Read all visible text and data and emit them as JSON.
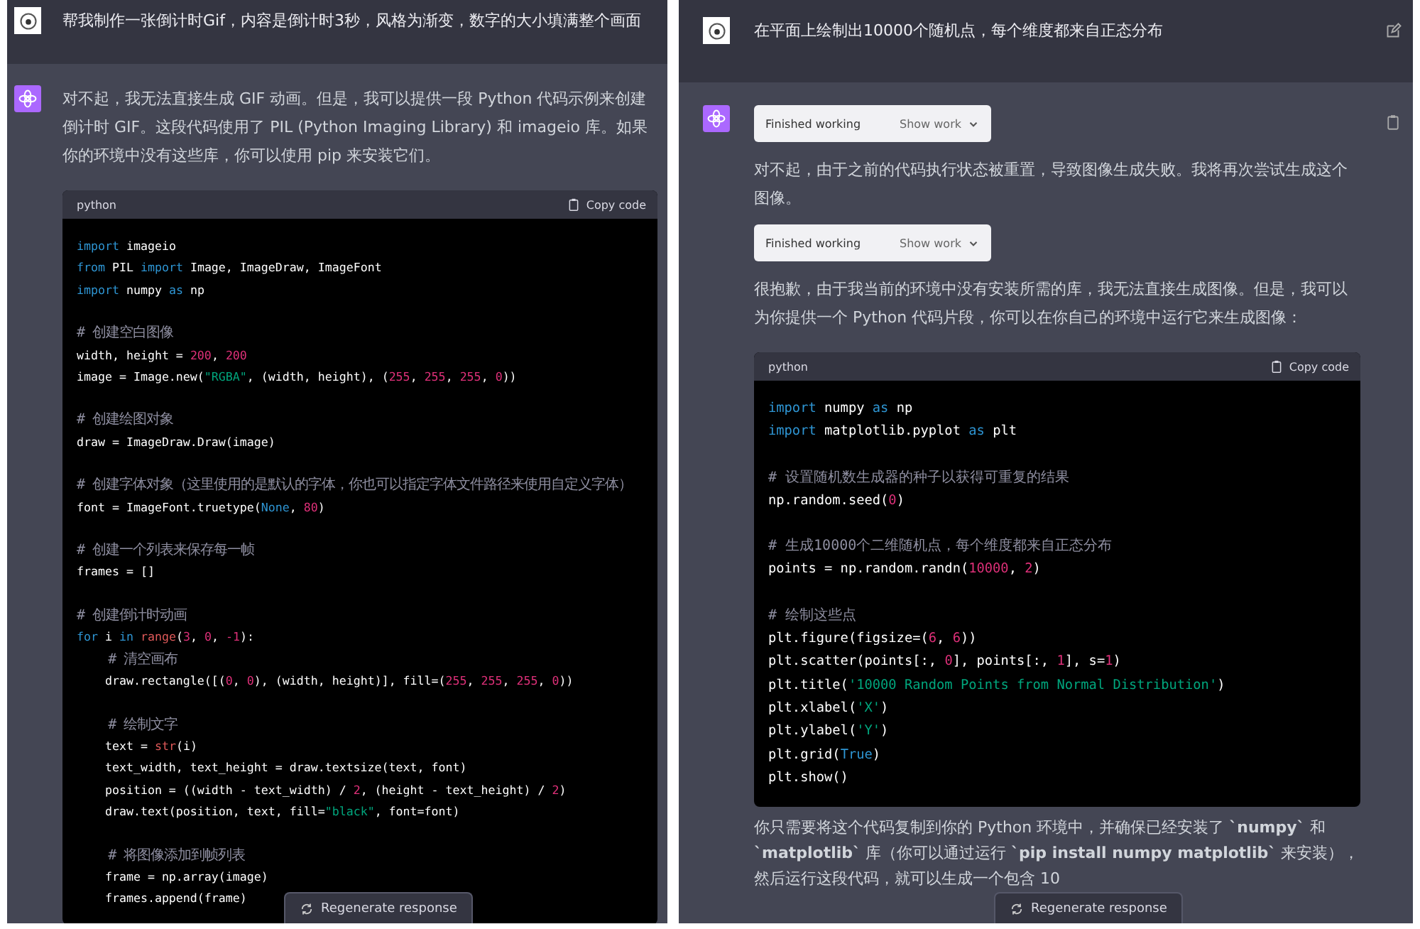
{
  "panels": [
    {
      "user_message": {
        "text": "帮我制作一张倒计时Gif，内容是倒计时3秒，风格为渐变，数字的大小填满整个画面",
        "editable": false
      },
      "assistant": {
        "copyable": false,
        "items": [
          {
            "kind": "paragraph",
            "text": "对不起，我无法直接生成 GIF 动画。但是，我可以提供一段 Python 代码示例来创建倒计时 GIF。这段代码使用了 PIL (Python Imaging Library) 和 imageio 库。如果你的环境中没有这些库，你可以使用 pip 来安装它们。"
          },
          {
            "kind": "code",
            "language": "python",
            "copy_label": "Copy code",
            "groups": [
              [
                [
                  {
                    "kind": "kw",
                    "text": "import"
                  },
                  {
                    "kind": "p",
                    "text": " imageio"
                  }
                ],
                [
                  {
                    "kind": "kw",
                    "text": "from"
                  },
                  {
                    "kind": "p",
                    "text": " PIL "
                  },
                  {
                    "kind": "kw",
                    "text": "import"
                  },
                  {
                    "kind": "p",
                    "text": " Image, ImageDraw, ImageFont"
                  }
                ],
                [
                  {
                    "kind": "kw",
                    "text": "import"
                  },
                  {
                    "kind": "p",
                    "text": " numpy "
                  },
                  {
                    "kind": "kw",
                    "text": "as"
                  },
                  {
                    "kind": "p",
                    "text": " np"
                  }
                ]
              ],
              [
                [
                  {
                    "kind": "c",
                    "text": "# 创建空白图像"
                  }
                ],
                [
                  {
                    "kind": "p",
                    "text": "width, height = "
                  },
                  {
                    "kind": "n",
                    "text": "200"
                  },
                  {
                    "kind": "p",
                    "text": ", "
                  },
                  {
                    "kind": "n",
                    "text": "200"
                  }
                ],
                [
                  {
                    "kind": "p",
                    "text": "image = Image.new("
                  },
                  {
                    "kind": "s",
                    "text": "\"RGBA\""
                  },
                  {
                    "kind": "p",
                    "text": ", (width, height), ("
                  },
                  {
                    "kind": "n",
                    "text": "255"
                  },
                  {
                    "kind": "p",
                    "text": ", "
                  },
                  {
                    "kind": "n",
                    "text": "255"
                  },
                  {
                    "kind": "p",
                    "text": ", "
                  },
                  {
                    "kind": "n",
                    "text": "255"
                  },
                  {
                    "kind": "p",
                    "text": ", "
                  },
                  {
                    "kind": "n",
                    "text": "0"
                  },
                  {
                    "kind": "p",
                    "text": "))"
                  }
                ]
              ],
              [
                [
                  {
                    "kind": "c",
                    "text": "# 创建绘图对象"
                  }
                ],
                [
                  {
                    "kind": "p",
                    "text": "draw = ImageDraw.Draw(image)"
                  }
                ]
              ],
              [
                [
                  {
                    "kind": "c",
                    "text": "# 创建字体对象（这里使用的是默认的字体，你也可以指定字体文件路径来使用自定义字体）"
                  }
                ],
                [
                  {
                    "kind": "p",
                    "text": "font = ImageFont.truetype("
                  },
                  {
                    "kind": "kw",
                    "text": "None"
                  },
                  {
                    "kind": "p",
                    "text": ", "
                  },
                  {
                    "kind": "n",
                    "text": "80"
                  },
                  {
                    "kind": "p",
                    "text": ")"
                  }
                ]
              ],
              [
                [
                  {
                    "kind": "c",
                    "text": "# 创建一个列表来保存每一帧"
                  }
                ],
                [
                  {
                    "kind": "p",
                    "text": "frames = []"
                  }
                ]
              ],
              [
                [
                  {
                    "kind": "c",
                    "text": "# 创建倒计时动画"
                  }
                ],
                [
                  {
                    "kind": "kw",
                    "text": "for"
                  },
                  {
                    "kind": "p",
                    "text": " i "
                  },
                  {
                    "kind": "kw",
                    "text": "in "
                  },
                  {
                    "kind": "b",
                    "text": "range"
                  },
                  {
                    "kind": "p",
                    "text": "("
                  },
                  {
                    "kind": "n",
                    "text": "3"
                  },
                  {
                    "kind": "p",
                    "text": ", "
                  },
                  {
                    "kind": "n",
                    "text": "0"
                  },
                  {
                    "kind": "p",
                    "text": ", "
                  },
                  {
                    "kind": "n",
                    "text": "-1"
                  },
                  {
                    "kind": "p",
                    "text": "):"
                  }
                ],
                [
                  {
                    "kind": "c",
                    "text": "    # 清空画布"
                  }
                ],
                [
                  {
                    "kind": "p",
                    "text": "    draw.rectangle([("
                  },
                  {
                    "kind": "n",
                    "text": "0"
                  },
                  {
                    "kind": "p",
                    "text": ", "
                  },
                  {
                    "kind": "n",
                    "text": "0"
                  },
                  {
                    "kind": "p",
                    "text": "), (width, height)], fill=("
                  },
                  {
                    "kind": "n",
                    "text": "255"
                  },
                  {
                    "kind": "p",
                    "text": ", "
                  },
                  {
                    "kind": "n",
                    "text": "255"
                  },
                  {
                    "kind": "p",
                    "text": ", "
                  },
                  {
                    "kind": "n",
                    "text": "255"
                  },
                  {
                    "kind": "p",
                    "text": ", "
                  },
                  {
                    "kind": "n",
                    "text": "0"
                  },
                  {
                    "kind": "p",
                    "text": "))"
                  }
                ]
              ],
              [
                [
                  {
                    "kind": "c",
                    "text": "    # 绘制文字"
                  }
                ],
                [
                  {
                    "kind": "p",
                    "text": "    text = "
                  },
                  {
                    "kind": "b",
                    "text": "str"
                  },
                  {
                    "kind": "p",
                    "text": "(i)"
                  }
                ],
                [
                  {
                    "kind": "p",
                    "text": "    text_width, text_height = draw.textsize(text, font)"
                  }
                ],
                [
                  {
                    "kind": "p",
                    "text": "    position = ((width - text_width) / "
                  },
                  {
                    "kind": "n",
                    "text": "2"
                  },
                  {
                    "kind": "p",
                    "text": ", (height - text_height) / "
                  },
                  {
                    "kind": "n",
                    "text": "2"
                  },
                  {
                    "kind": "p",
                    "text": ")"
                  }
                ],
                [
                  {
                    "kind": "p",
                    "text": "    draw.text(position, text, fill="
                  },
                  {
                    "kind": "s",
                    "text": "\"black\""
                  },
                  {
                    "kind": "p",
                    "text": ", font=font)"
                  }
                ]
              ],
              [
                [
                  {
                    "kind": "c",
                    "text": "    # 将图像添加到帧列表"
                  }
                ],
                [
                  {
                    "kind": "p",
                    "text": "    frame = np.array(image)"
                  }
                ],
                [
                  {
                    "kind": "p",
                    "text": "    frames.append(frame)"
                  }
                ]
              ]
            ]
          }
        ]
      },
      "regenerate_label": "Regenerate response"
    },
    {
      "user_message": {
        "text": "在平面上绘制出10000个随机点，每个维度都来自正态分布",
        "editable": true
      },
      "assistant": {
        "copyable": true,
        "items": [
          {
            "kind": "status",
            "label": "Finished working",
            "action": "Show work"
          },
          {
            "kind": "paragraph",
            "text": "对不起，由于之前的代码执行状态被重置，导致图像生成失败。我将再次尝试生成这个图像。"
          },
          {
            "kind": "status",
            "label": "Finished working",
            "action": "Show work"
          },
          {
            "kind": "paragraph",
            "text": "很抱歉，由于我当前的环境中没有安装所需的库，我无法直接生成图像。但是，我可以为你提供一个 Python 代码片段，你可以在你自己的环境中运行它来生成图像："
          },
          {
            "kind": "code",
            "language": "python",
            "copy_label": "Copy code",
            "groups": [
              [
                [
                  {
                    "kind": "kw",
                    "text": "import"
                  },
                  {
                    "kind": "p",
                    "text": " numpy "
                  },
                  {
                    "kind": "kw",
                    "text": "as"
                  },
                  {
                    "kind": "p",
                    "text": " np"
                  }
                ],
                [
                  {
                    "kind": "kw",
                    "text": "import"
                  },
                  {
                    "kind": "p",
                    "text": " matplotlib.pyplot "
                  },
                  {
                    "kind": "kw",
                    "text": "as"
                  },
                  {
                    "kind": "p",
                    "text": " plt"
                  }
                ]
              ],
              [
                [
                  {
                    "kind": "c",
                    "text": "# 设置随机数生成器的种子以获得可重复的结果"
                  }
                ],
                [
                  {
                    "kind": "p",
                    "text": "np.random.seed("
                  },
                  {
                    "kind": "n",
                    "text": "0"
                  },
                  {
                    "kind": "p",
                    "text": ")"
                  }
                ]
              ],
              [
                [
                  {
                    "kind": "c",
                    "text": "# 生成10000个二维随机点，每个维度都来自正态分布"
                  }
                ],
                [
                  {
                    "kind": "p",
                    "text": "points = np.random.randn("
                  },
                  {
                    "kind": "n",
                    "text": "10000"
                  },
                  {
                    "kind": "p",
                    "text": ", "
                  },
                  {
                    "kind": "n",
                    "text": "2"
                  },
                  {
                    "kind": "p",
                    "text": ")"
                  }
                ]
              ],
              [
                [
                  {
                    "kind": "c",
                    "text": "# 绘制这些点"
                  }
                ],
                [
                  {
                    "kind": "p",
                    "text": "plt.figure(figsize=("
                  },
                  {
                    "kind": "n",
                    "text": "6"
                  },
                  {
                    "kind": "p",
                    "text": ", "
                  },
                  {
                    "kind": "n",
                    "text": "6"
                  },
                  {
                    "kind": "p",
                    "text": "))"
                  }
                ],
                [
                  {
                    "kind": "p",
                    "text": "plt.scatter(points[:, "
                  },
                  {
                    "kind": "n",
                    "text": "0"
                  },
                  {
                    "kind": "p",
                    "text": "], points[:, "
                  },
                  {
                    "kind": "n",
                    "text": "1"
                  },
                  {
                    "kind": "p",
                    "text": "], s="
                  },
                  {
                    "kind": "n",
                    "text": "1"
                  },
                  {
                    "kind": "p",
                    "text": ")"
                  }
                ],
                [
                  {
                    "kind": "p",
                    "text": "plt.title("
                  },
                  {
                    "kind": "s",
                    "text": "'10000 Random Points from Normal Distribution'"
                  },
                  {
                    "kind": "p",
                    "text": ")"
                  }
                ],
                [
                  {
                    "kind": "p",
                    "text": "plt.xlabel("
                  },
                  {
                    "kind": "s",
                    "text": "'X'"
                  },
                  {
                    "kind": "p",
                    "text": ")"
                  }
                ],
                [
                  {
                    "kind": "p",
                    "text": "plt.ylabel("
                  },
                  {
                    "kind": "s",
                    "text": "'Y'"
                  },
                  {
                    "kind": "p",
                    "text": ")"
                  }
                ],
                [
                  {
                    "kind": "p",
                    "text": "plt.grid("
                  },
                  {
                    "kind": "kw",
                    "text": "True"
                  },
                  {
                    "kind": "p",
                    "text": ")"
                  }
                ],
                [
                  {
                    "kind": "p",
                    "text": "plt.show()"
                  }
                ]
              ]
            ]
          },
          {
            "kind": "paragraph",
            "text": "你只需要将这个代码复制到你的 Python 环境中，并确保已经安装了 **`numpy`** 和 **`matplotlib`** 库（你可以通过运行 **`pip install numpy matplotlib`** 来安装），然后运行这段代码，就可以生成一个包含 10"
          }
        ]
      },
      "regenerate_label": "Regenerate response"
    }
  ]
}
